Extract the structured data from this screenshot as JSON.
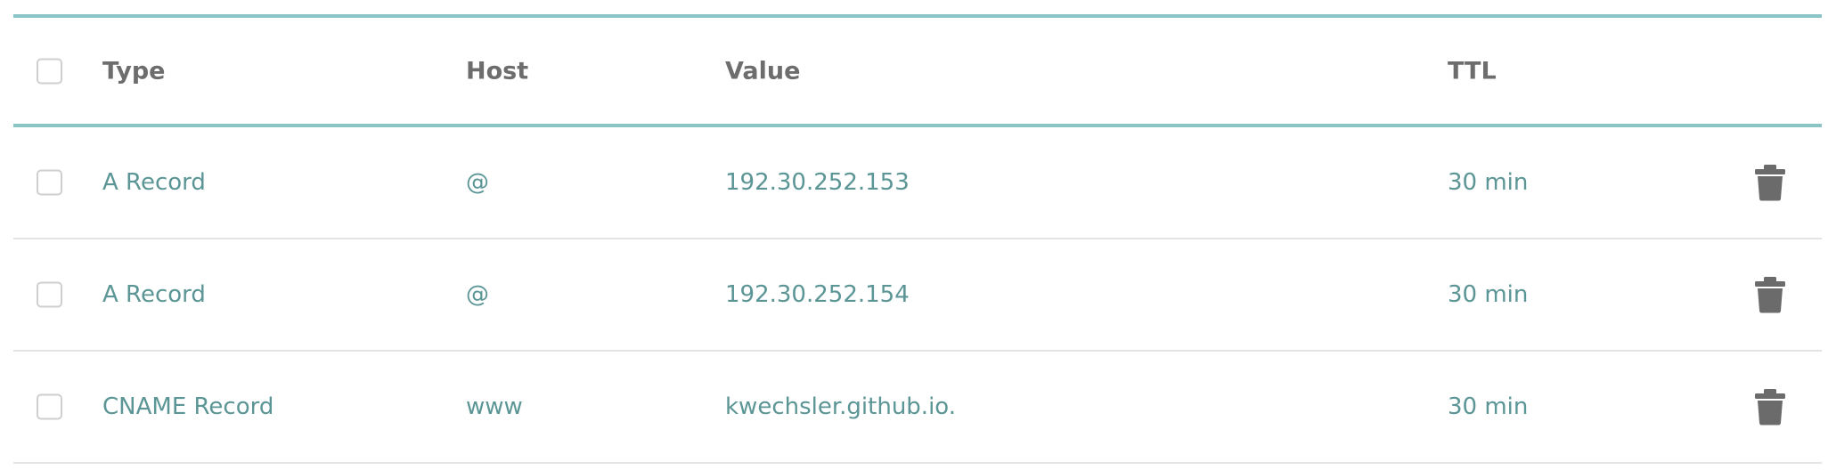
{
  "table": {
    "columns": {
      "type": "Type",
      "host": "Host",
      "value": "Value",
      "ttl": "TTL"
    },
    "records": [
      {
        "type": "A Record",
        "host": "@",
        "value": "192.30.252.153",
        "ttl": "30 min"
      },
      {
        "type": "A Record",
        "host": "@",
        "value": "192.30.252.154",
        "ttl": "30 min"
      },
      {
        "type": "CNAME Record",
        "host": "www",
        "value": "kwechsler.github.io.",
        "ttl": "30 min"
      }
    ]
  },
  "icons": {
    "delete": "trash-icon"
  },
  "colors": {
    "accent": "#8ac4c4",
    "header_text": "#6d6d6d",
    "cell_text": "#5b9595",
    "icon": "#6b6b6b",
    "checkbox_border": "#cfcfcf",
    "row_divider": "#e4e4e4"
  }
}
